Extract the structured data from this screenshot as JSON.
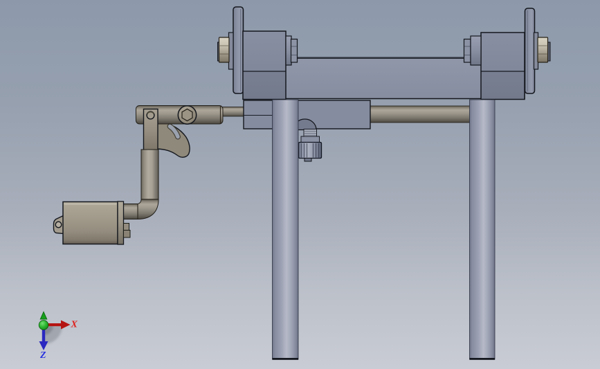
{
  "viewport": {
    "kind": "3d-cad-assembly-view"
  },
  "axis_triad": {
    "x_label": "X",
    "z_label": "Z",
    "x_color": "#e01d18",
    "z_color": "#2531e0",
    "y_color": "#17a01b",
    "origin_color": "#18a51c"
  },
  "colors": {
    "background_top": "#8d99ab",
    "background_bottom": "#c9ccd4",
    "frame_blue_gray": "#8b92a4",
    "block_blue_gray": "#7f8598",
    "rod_warm_gray": "#9a948a",
    "motor_tan": "#a19a8b",
    "nut_bone": "#cbc5b5"
  },
  "model": {
    "parts": [
      "wheel-disc-left",
      "wheel-disc-right",
      "axle-nut-left",
      "axle-nut-right",
      "bearing-block-left",
      "bearing-block-right",
      "axle-shaft",
      "crossbeam",
      "clamp-block",
      "clamp-knob",
      "cross-rod",
      "leg-left",
      "leg-right",
      "pivot-arm",
      "tilt-bracket",
      "pivot-bolt",
      "arm-tube",
      "motor-body",
      "motor-mount-tab"
    ]
  }
}
